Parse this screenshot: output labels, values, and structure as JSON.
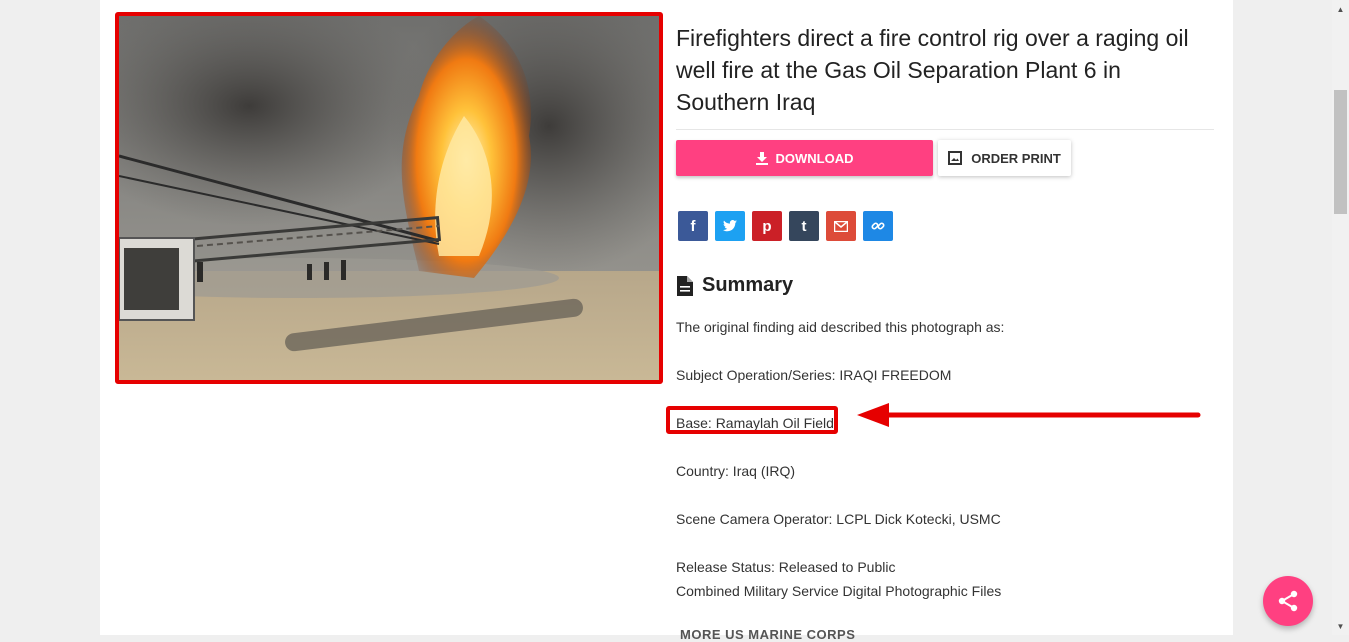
{
  "photo": {
    "alt": "Oil well fire with fire control rig"
  },
  "title": "Firefighters direct a fire control rig over a raging oil well fire at the Gas Oil Separation Plant 6 in Southern Iraq",
  "actions": {
    "download_label": "DOWNLOAD",
    "print_label": "ORDER PRINT"
  },
  "share": {
    "buttons": [
      {
        "name": "facebook",
        "glyph": "f",
        "color": "#3b5998"
      },
      {
        "name": "twitter",
        "glyph": "t",
        "color": "#1da1f2"
      },
      {
        "name": "pinterest",
        "glyph": "p",
        "color": "#cb2027"
      },
      {
        "name": "tumblr",
        "glyph": "t",
        "color": "#35465c"
      },
      {
        "name": "gmail",
        "glyph": "M",
        "color": "#dd4b39"
      },
      {
        "name": "link",
        "glyph": "∞",
        "color": "#1e88e5"
      }
    ]
  },
  "summary": {
    "heading": "Summary",
    "intro": "The original finding aid described this photograph as:",
    "subject": "Subject Operation/Series: IRAQI FREEDOM",
    "base": "Base: Ramaylah Oil Field",
    "country": "Country: Iraq (IRQ)",
    "operator": "Scene Camera Operator: LCPL Dick Kotecki, USMC",
    "release": "Release Status: Released to Public",
    "files": "Combined Military Service Digital Photographic Files"
  },
  "more_link": "MORE US MARINE CORPS",
  "colors": {
    "accent": "#ff4081",
    "annotation": "#e60000"
  }
}
